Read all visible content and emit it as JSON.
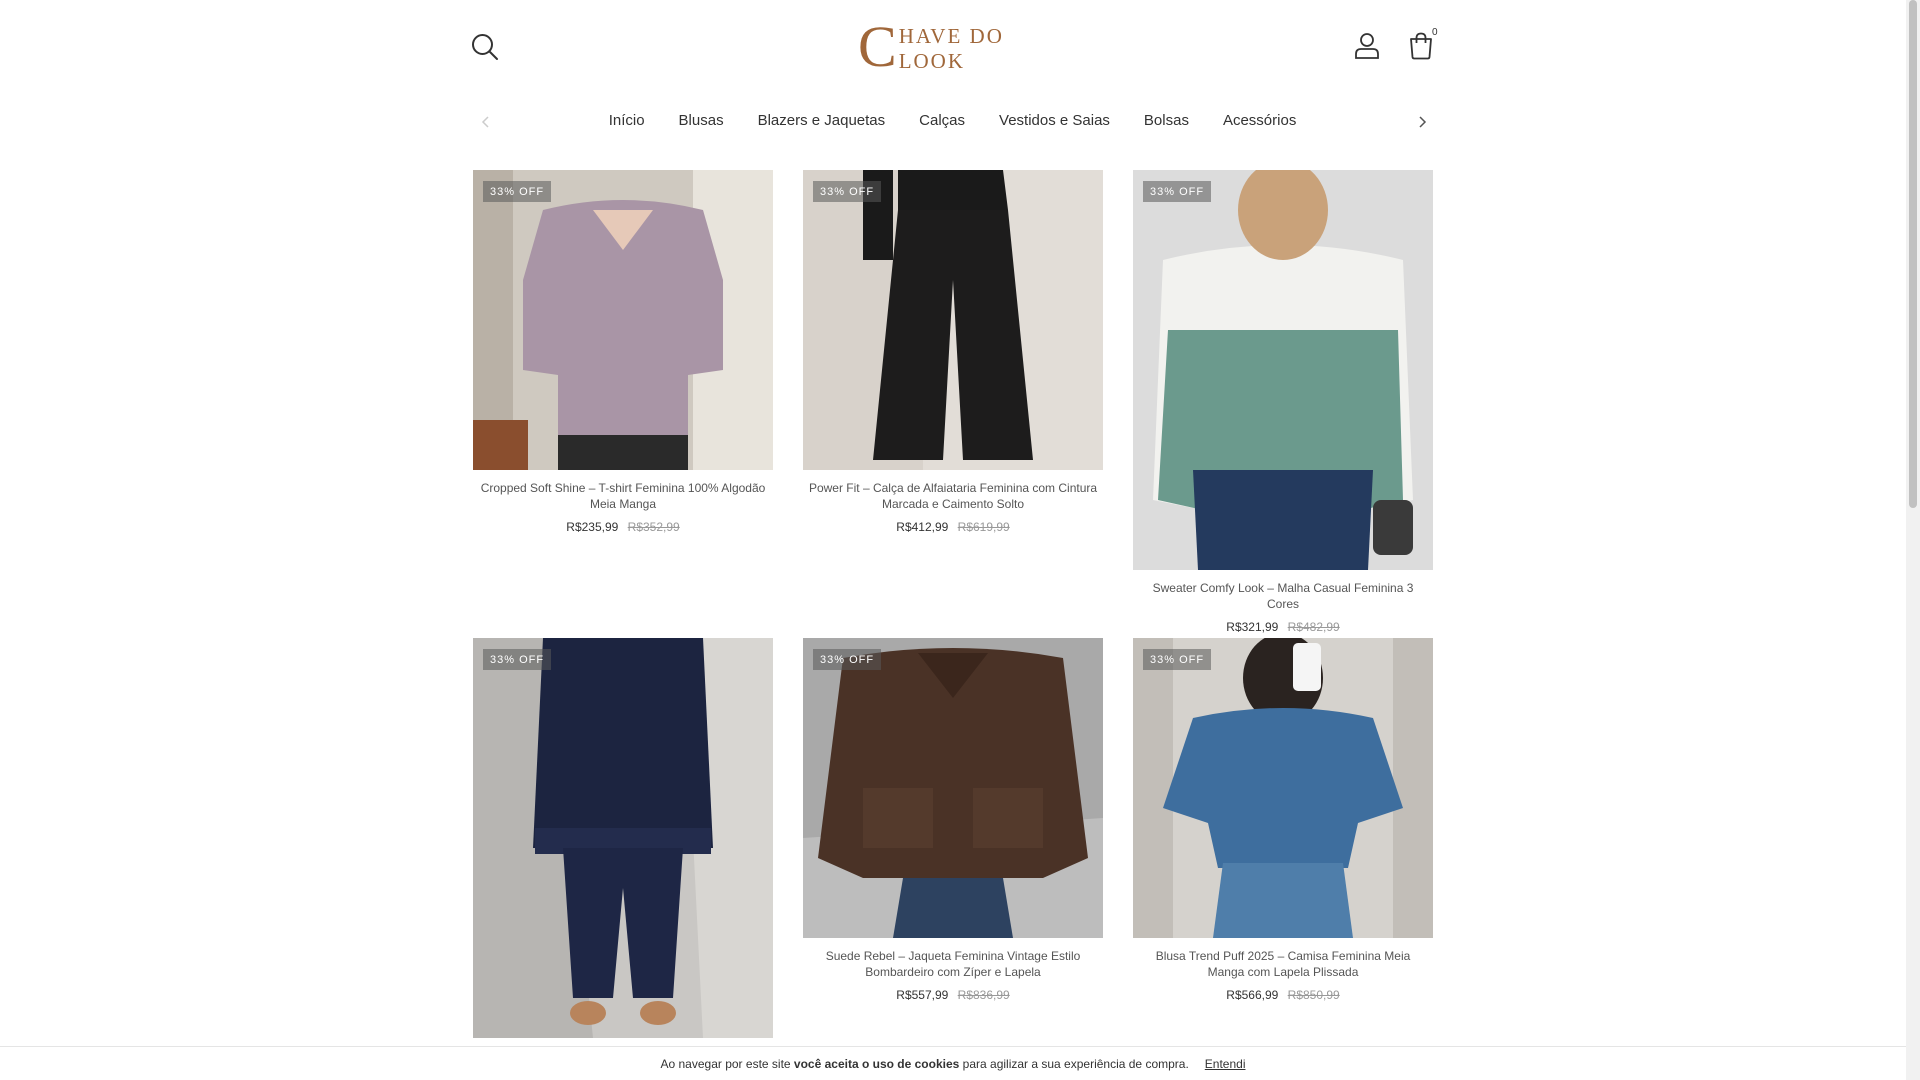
{
  "header": {
    "logo_initial": "C",
    "logo_text": "HAVE DO LOOK",
    "cart_count": "0"
  },
  "nav": {
    "items": [
      "Início",
      "Blusas",
      "Blazers e Jaquetas",
      "Calças",
      "Vestidos e Saias",
      "Bolsas",
      "Acessórios"
    ]
  },
  "products": [
    {
      "badge": "33% OFF",
      "name": "Cropped Soft Shine – T-shirt Feminina 100% Algodão Meia Manga",
      "price": "R$235,99",
      "old_price": "R$352,99",
      "image": "lilac-v-neck-tshirt-photo"
    },
    {
      "badge": "33% OFF",
      "name": "Power Fit – Calça de Alfaiataria Feminina com Cintura Marcada e Caimento Solto",
      "price": "R$412,99",
      "old_price": "R$619,99",
      "image": "black-wide-leg-trousers-photo"
    },
    {
      "badge": "33% OFF",
      "name": "Sweater Comfy Look – Malha Casual Feminina 3 Cores",
      "price": "R$321,99",
      "old_price": "R$482,99",
      "image": "white-green-striped-sweater-photo"
    },
    {
      "badge": "33% OFF",
      "name": "",
      "price": "",
      "old_price": "",
      "image": "denim-belted-jacket-photo"
    },
    {
      "badge": "33% OFF",
      "name": "Suede Rebel – Jaqueta Feminina Vintage Estilo Bombardeiro com Zíper e Lapela",
      "price": "R$557,99",
      "old_price": "R$836,99",
      "image": "brown-suede-jacket-photo"
    },
    {
      "badge": "33% OFF",
      "name": "Blusa Trend Puff 2025 – Camisa Feminina Meia Manga com Lapela Plissada",
      "price": "R$566,99",
      "old_price": "R$850,99",
      "image": "denim-puff-sleeve-shirt-photo"
    }
  ],
  "cookie": {
    "text_before": "Ao navegar por este site ",
    "text_bold": "você aceita o uso de cookies",
    "text_after": " para agilizar a sua experiência de compra.",
    "accept_label": "Entendi"
  },
  "colors": {
    "brand": "#a0673a"
  }
}
